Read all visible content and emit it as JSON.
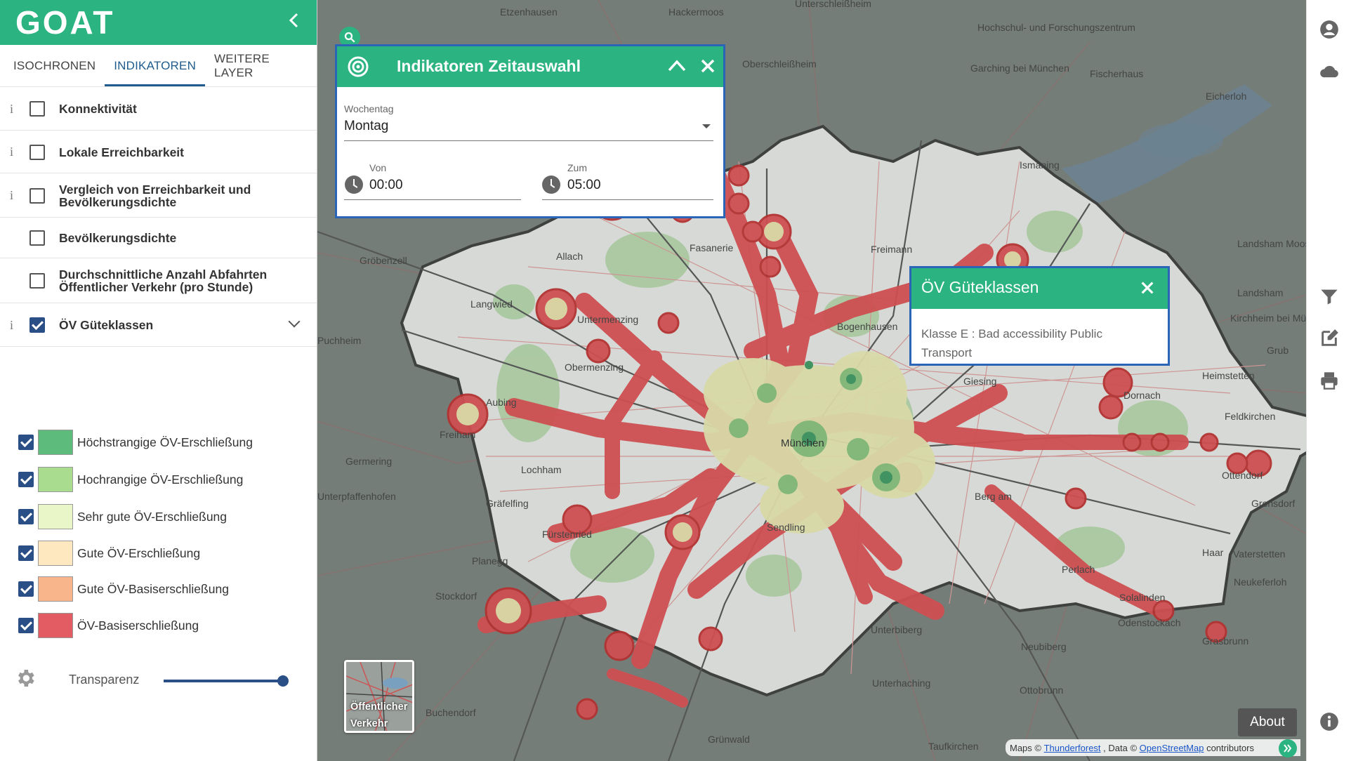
{
  "app": {
    "logo": "GOAT"
  },
  "tabs": [
    {
      "label": "ISOCHRONEN"
    },
    {
      "label": "INDIKATOREN"
    },
    {
      "label": "WEITERE LAYER"
    }
  ],
  "indicators": [
    {
      "label": "Konnektivität",
      "checked": false,
      "info": "i"
    },
    {
      "label": "Lokale Erreichbarkeit",
      "checked": false,
      "info": "i"
    },
    {
      "label": "Vergleich von Erreichbarkeit und Bevölkerungsdichte",
      "checked": false,
      "info": "i"
    },
    {
      "label": "Bevölkerungsdichte",
      "checked": false,
      "info": ""
    },
    {
      "label": "Durchschnittliche Anzahl Abfahrten Öffentlicher Verkehr (pro Stunde)",
      "checked": false,
      "info": ""
    },
    {
      "label": "ÖV Güteklassen",
      "checked": true,
      "info": "i"
    }
  ],
  "legend": [
    {
      "label": "Höchstrangige ÖV-Erschließung",
      "color": "#5dbb7c",
      "checked": true
    },
    {
      "label": "Hochrangige ÖV-Erschließung",
      "color": "#a9dc8f",
      "checked": true
    },
    {
      "label": "Sehr gute ÖV-Erschließung",
      "color": "#e9f6c8",
      "checked": true
    },
    {
      "label": "Gute ÖV-Erschließung",
      "color": "#fde8bf",
      "checked": true
    },
    {
      "label": "Gute ÖV-Basiserschließung",
      "color": "#f8b48a",
      "checked": true
    },
    {
      "label": "ÖV-Basiserschließung",
      "color": "#e45c63",
      "checked": true
    }
  ],
  "transparency": {
    "label": "Transparenz",
    "value": 1.0
  },
  "time_panel": {
    "title": "Indikatoren Zeitauswahl",
    "weekday_label": "Wochentag",
    "weekday_value": "Montag",
    "from_label": "Von",
    "from_value": "00:00",
    "to_label": "Zum",
    "to_value": "05:00"
  },
  "popup": {
    "title": "ÖV Güteklassen",
    "body": "Klasse E : Bad accessibility Public Transport"
  },
  "basemap": {
    "label": "Öffentlicher Verkehr"
  },
  "about": "About",
  "attribution": {
    "prefix": "Maps ©",
    "link1": "Thunderforest",
    "mid": ", Data ©",
    "link2": "OpenStreetMap",
    "suffix": "contributors"
  },
  "map_labels": [
    "Etzenhausen",
    "Hackermoos",
    "Unterschleißheim",
    "Hochschul- und Forschungszentrum",
    "Oberschleißheim",
    "Garching bei München",
    "Fischerhaus",
    "Eicherloh",
    "Ismaning",
    "Landsham Moos",
    "Landsham",
    "Kirchheim bei München",
    "Heimstetten",
    "Grub",
    "Dornach",
    "Feldkirchen",
    "Ottendorf",
    "Gronsdorf",
    "Haar",
    "Vaterstetten",
    "Neukeferloh",
    "Solalinden",
    "Ödenstockach",
    "Grasbrunn",
    "Neubiberg",
    "Unterbiberg",
    "Ottobrunn",
    "Unterhaching",
    "Taufkirchen",
    "Grünwald",
    "Buchendorf",
    "Stockdorf",
    "Planegg",
    "Gräfelfing",
    "Lochham",
    "Unterpfaffenhofen",
    "Germering",
    "Freiham",
    "Aubing",
    "Langwied",
    "Puchheim",
    "Gröbenzell",
    "Allach",
    "Untermenzing",
    "Obermenzing",
    "Fasanerie",
    "Freimann",
    "Berg am",
    "Perlach",
    "Fürstenried",
    "Sendling",
    "Giesing",
    "Bogenhausen",
    "München"
  ],
  "colors": {
    "brand": "#2bb381",
    "selected": "#2a4f86",
    "panel_border": "#2a65b8"
  },
  "icons": {
    "user": "user-icon",
    "cloud": "cloud-icon",
    "filter": "filter-icon",
    "edit": "edit-icon",
    "print": "print-icon",
    "info": "info-icon",
    "settings": "gear-icon",
    "search": "search-icon"
  }
}
